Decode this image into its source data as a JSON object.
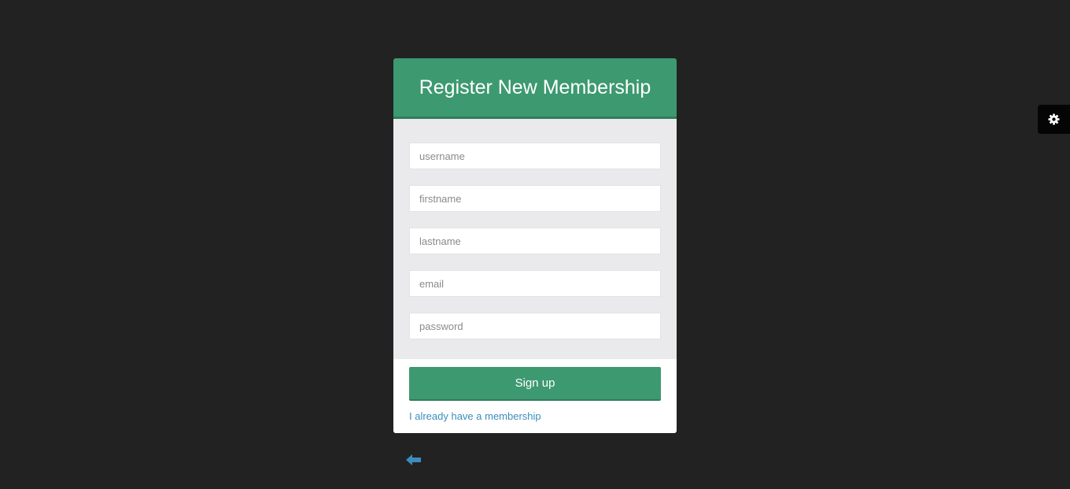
{
  "register": {
    "title": "Register New Membership",
    "fields": {
      "username": {
        "placeholder": "username",
        "value": ""
      },
      "firstname": {
        "placeholder": "firstname",
        "value": ""
      },
      "lastname": {
        "placeholder": "lastname",
        "value": ""
      },
      "email": {
        "placeholder": "email",
        "value": ""
      },
      "password": {
        "placeholder": "password",
        "value": ""
      }
    },
    "signup_label": "Sign up",
    "login_link": "I already have a membership"
  },
  "icons": {
    "back": "arrow-left-icon",
    "settings": "gear-icon"
  },
  "colors": {
    "background": "#222222",
    "accent": "#3d9970",
    "link": "#3c8dbc",
    "form_body": "#eaeaec"
  }
}
